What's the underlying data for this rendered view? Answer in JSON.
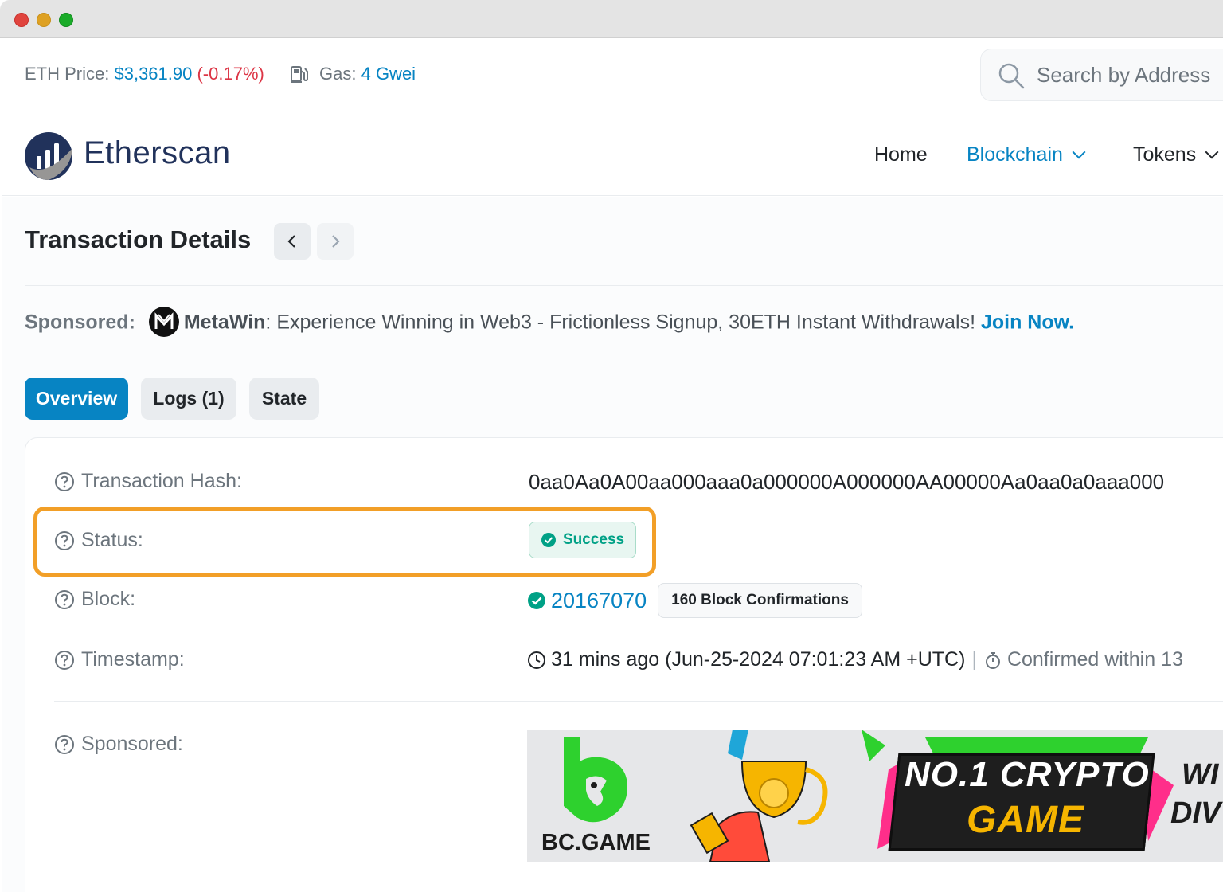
{
  "stats": {
    "eth_price_label": "ETH Price:",
    "eth_price_value": "$3,361.90",
    "eth_price_change": "(-0.17%)",
    "gas_label": "Gas:",
    "gas_value": "4 Gwei"
  },
  "search": {
    "placeholder": "Search by Address"
  },
  "brand": {
    "name": "Etherscan"
  },
  "nav": {
    "home": "Home",
    "blockchain": "Blockchain",
    "tokens": "Tokens"
  },
  "page": {
    "title": "Transaction Details"
  },
  "sponsor_line": {
    "label": "Sponsored:",
    "name": "MetaWin",
    "text": ": Experience Winning in Web3 - Frictionless Signup, 30ETH Instant Withdrawals! ",
    "cta": "Join Now."
  },
  "tabs": [
    {
      "label": "Overview",
      "active": true
    },
    {
      "label": "Logs (1)",
      "active": false
    },
    {
      "label": "State",
      "active": false
    }
  ],
  "details": {
    "hash_label": "Transaction Hash:",
    "hash_value": "0aa0Aa0A00aa000aaa0a000000A000000AA00000Aa0aa0a0aaa000",
    "status_label": "Status:",
    "status_value": "Success",
    "block_label": "Block:",
    "block_value": "20167070",
    "block_confirmations": "160 Block Confirmations",
    "timestamp_label": "Timestamp:",
    "timestamp_value": "31 mins ago (Jun-25-2024 07:01:23 AM +UTC)",
    "timestamp_sep": "|",
    "confirmed_within": "Confirmed within 13",
    "sponsored_label": "Sponsored:"
  },
  "banner": {
    "logo_text": "BC.GAME",
    "headline_1": "NO.1 CRYPTO",
    "headline_2": "GAME",
    "right_1": "WI",
    "right_2": "DIV"
  },
  "colors": {
    "accent": "#0784c3",
    "negative": "#dc3545",
    "success": "#00a186",
    "highlight": "#f29f27"
  }
}
